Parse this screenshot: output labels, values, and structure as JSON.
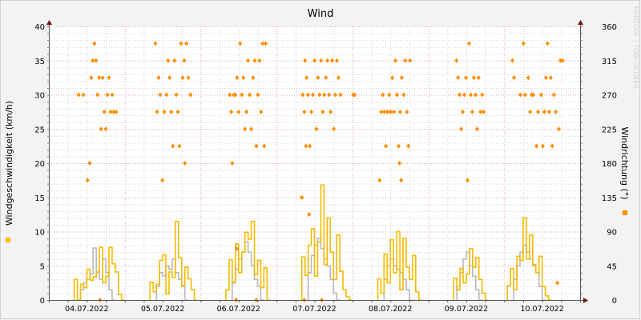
{
  "chart_data": {
    "type": "line",
    "title": "Wind",
    "ylabel": "Windgeschwindigkeit (km/h)",
    "y2label": "Windrichtung (°)",
    "watermark": "RRDTOOL / TOBI OETIKER",
    "ylim": [
      0,
      40
    ],
    "y2lim": [
      0,
      360
    ],
    "yticks": [
      "0",
      "5",
      "10",
      "15",
      "20",
      "25",
      "30",
      "35",
      "40"
    ],
    "y2ticks": [
      "0",
      "45",
      "90",
      "135",
      "180",
      "225",
      "270",
      "315",
      "360"
    ],
    "x_hours_total": 168,
    "xticks": [
      "04.07.2022",
      "05.07.2022",
      "06.07.2022",
      "07.07.2022",
      "08.07.2022",
      "09.07.2022",
      "10.07.2022"
    ],
    "grid": true,
    "colors": {
      "speed": "#F5BA00",
      "secondary": "#B8B8C0",
      "direction": "#FF8C00",
      "axis": "#7a1010"
    },
    "speed_segments": [
      {
        "start": 8,
        "values": [
          3,
          0,
          2.3,
          1.8,
          4.5,
          2.9,
          3.4,
          4.1,
          7.7,
          2.5,
          3.5,
          7.7,
          5.3,
          4.1,
          0.8,
          0
        ]
      },
      {
        "start": 32,
        "values": [
          2.6,
          1.2,
          2.3,
          5.8,
          6.6,
          0.9,
          4.1,
          3.3,
          11.5,
          6.2,
          2.1,
          4.8,
          3.1,
          1.5,
          0
        ]
      },
      {
        "start": 56,
        "values": [
          1.5,
          5.9,
          2.6,
          8.2,
          4,
          7,
          9.9,
          8.9,
          11.5,
          3.7,
          5.8,
          1.8,
          4.7,
          0
        ]
      },
      {
        "start": 80,
        "values": [
          6.3,
          3.6,
          8,
          10.4,
          3.5,
          8.5,
          16.8,
          5.2,
          12,
          7,
          3,
          9.5,
          4.2,
          1.5,
          0.5,
          0
        ]
      },
      {
        "start": 104,
        "values": [
          3.1,
          1,
          6.7,
          2.5,
          8.8,
          4,
          10,
          1.5,
          9,
          4.8,
          3,
          6.5,
          1.2,
          0
        ]
      },
      {
        "start": 128,
        "values": [
          3.2,
          1.5,
          4.6,
          2.5,
          3.8,
          7.5,
          4.8,
          6.2,
          3,
          1,
          0
        ]
      },
      {
        "start": 145,
        "values": [
          2.1,
          4.6,
          1.5,
          6.4,
          5.8,
          12,
          6,
          9.5,
          5.2,
          4,
          6.4,
          2,
          0.6,
          0
        ]
      }
    ],
    "secondary_segments": [
      {
        "start": 10,
        "values": [
          1.5,
          2.5,
          3,
          3.8,
          7.6,
          4,
          3,
          6,
          4,
          1.5,
          0
        ]
      },
      {
        "start": 34,
        "values": [
          2,
          4,
          3.5,
          5,
          4.5,
          6,
          4,
          3,
          2,
          0
        ]
      },
      {
        "start": 58,
        "values": [
          2.5,
          4.5,
          6,
          7,
          8.5,
          7,
          5,
          3,
          2,
          0
        ]
      },
      {
        "start": 82,
        "values": [
          4,
          6.5,
          8,
          9,
          7.5,
          6,
          5,
          3,
          1,
          0
        ]
      },
      {
        "start": 106,
        "values": [
          3,
          5,
          6,
          5,
          4.5,
          4,
          3,
          1.5,
          0
        ]
      },
      {
        "start": 129,
        "values": [
          2,
          4,
          6,
          7,
          5,
          3.5,
          1.5,
          0
        ]
      },
      {
        "start": 147,
        "values": [
          3,
          5,
          7,
          8,
          7,
          6,
          5,
          4,
          2,
          0
        ]
      }
    ],
    "direction_points": [
      [
        9.4,
        270
      ],
      [
        10.9,
        270
      ],
      [
        12.2,
        157.5
      ],
      [
        12.9,
        180
      ],
      [
        13.4,
        292.5
      ],
      [
        13.9,
        315
      ],
      [
        14.4,
        337.5
      ],
      [
        14.9,
        315
      ],
      [
        15.4,
        270
      ],
      [
        15.9,
        292.5
      ],
      [
        16.2,
        0
      ],
      [
        16.5,
        225
      ],
      [
        17,
        292.5
      ],
      [
        17.5,
        247.5
      ],
      [
        18,
        225
      ],
      [
        18.5,
        270
      ],
      [
        19,
        292.5
      ],
      [
        19.5,
        247.5
      ],
      [
        20,
        270
      ],
      [
        20.5,
        247.5
      ],
      [
        21.3,
        247.5
      ],
      [
        33.7,
        337.5
      ],
      [
        34.2,
        247.5
      ],
      [
        34.7,
        292.5
      ],
      [
        35.2,
        270
      ],
      [
        35.9,
        157.5
      ],
      [
        36.5,
        247.5
      ],
      [
        37.2,
        270
      ],
      [
        37.7,
        315
      ],
      [
        38.2,
        292.5
      ],
      [
        38.7,
        247.5
      ],
      [
        39.2,
        202.5
      ],
      [
        39.7,
        315
      ],
      [
        40.3,
        270
      ],
      [
        40.8,
        247.5
      ],
      [
        41.3,
        202.5
      ],
      [
        41.8,
        337.5
      ],
      [
        42.3,
        292.5
      ],
      [
        42.8,
        315
      ],
      [
        43,
        180
      ],
      [
        43.5,
        337.5
      ],
      [
        44.1,
        292.5
      ],
      [
        44.8,
        270
      ],
      [
        57.2,
        270
      ],
      [
        57.7,
        247.5
      ],
      [
        58,
        180
      ],
      [
        58.5,
        270
      ],
      [
        59,
        270
      ],
      [
        59.2,
        0
      ],
      [
        59.4,
        67.5
      ],
      [
        59.5,
        292.5
      ],
      [
        60,
        247.5
      ],
      [
        60.5,
        337.5
      ],
      [
        61,
        270
      ],
      [
        61.5,
        292.5
      ],
      [
        62,
        225
      ],
      [
        62.5,
        247.5
      ],
      [
        63,
        315
      ],
      [
        63.5,
        270
      ],
      [
        64,
        225
      ],
      [
        64.6,
        292.5
      ],
      [
        65.1,
        315
      ],
      [
        65.6,
        0
      ],
      [
        65.6,
        202.5
      ],
      [
        66.1,
        270
      ],
      [
        66.6,
        315
      ],
      [
        67.1,
        247.5
      ],
      [
        67.6,
        337.5
      ],
      [
        68.1,
        202.5
      ],
      [
        68.6,
        337.5
      ],
      [
        80,
        135
      ],
      [
        80.3,
        270
      ],
      [
        80.8,
        0
      ],
      [
        80.8,
        247.5
      ],
      [
        81,
        315
      ],
      [
        81.3,
        202.5
      ],
      [
        81.5,
        292.5
      ],
      [
        82,
        270
      ],
      [
        82.3,
        112.5
      ],
      [
        82.5,
        202.5
      ],
      [
        83,
        247.5
      ],
      [
        83.5,
        270
      ],
      [
        84,
        315
      ],
      [
        84.6,
        225
      ],
      [
        85.1,
        292.5
      ],
      [
        85.6,
        270
      ],
      [
        86.1,
        315
      ],
      [
        86.3,
        0
      ],
      [
        86.6,
        247.5
      ],
      [
        87.1,
        270
      ],
      [
        87.6,
        292.5
      ],
      [
        88.1,
        315
      ],
      [
        88.6,
        270
      ],
      [
        89.1,
        247.5
      ],
      [
        89.6,
        315
      ],
      [
        90.1,
        225
      ],
      [
        90.6,
        270
      ],
      [
        91.1,
        315
      ],
      [
        91.6,
        292.5
      ],
      [
        92.2,
        270
      ],
      [
        96.2,
        270
      ],
      [
        96.7,
        270
      ],
      [
        104.6,
        157.5
      ],
      [
        105.1,
        247.5
      ],
      [
        105.6,
        270
      ],
      [
        106.1,
        247.5
      ],
      [
        106.6,
        202.5
      ],
      [
        107.1,
        247.5
      ],
      [
        107.6,
        270
      ],
      [
        108.1,
        247.5
      ],
      [
        108.6,
        292.5
      ],
      [
        109.1,
        247.5
      ],
      [
        109.6,
        315
      ],
      [
        110.1,
        270
      ],
      [
        110.6,
        202.5
      ],
      [
        110.9,
        180
      ],
      [
        111.1,
        247.5
      ],
      [
        111.4,
        157.5
      ],
      [
        111.6,
        292.5
      ],
      [
        112.2,
        270
      ],
      [
        112.7,
        315
      ],
      [
        113.2,
        247.5
      ],
      [
        113.7,
        202.5
      ],
      [
        114.2,
        315
      ],
      [
        128.9,
        315
      ],
      [
        129.4,
        292.5
      ],
      [
        129.9,
        270
      ],
      [
        130.4,
        225
      ],
      [
        130.9,
        247.5
      ],
      [
        131.4,
        270
      ],
      [
        131.9,
        292.5
      ],
      [
        132.4,
        157.5
      ],
      [
        132.9,
        337.5
      ],
      [
        133.4,
        270
      ],
      [
        133.9,
        247.5
      ],
      [
        134.4,
        292.5
      ],
      [
        134.9,
        270
      ],
      [
        135.4,
        225
      ],
      [
        135.9,
        292.5
      ],
      [
        136.5,
        247.5
      ],
      [
        137,
        270
      ],
      [
        137.5,
        247.5
      ],
      [
        146.6,
        315
      ],
      [
        147.1,
        292.5
      ],
      [
        149.1,
        270
      ],
      [
        150.1,
        337.5
      ],
      [
        150.6,
        270
      ],
      [
        151.6,
        292.5
      ],
      [
        152.2,
        247.5
      ],
      [
        152.7,
        270
      ],
      [
        153.2,
        270
      ],
      [
        154.2,
        202.5
      ],
      [
        154.7,
        247.5
      ],
      [
        155.7,
        270
      ],
      [
        156.2,
        202.5
      ],
      [
        156.7,
        247.5
      ],
      [
        157.2,
        292.5
      ],
      [
        157.7,
        337.5
      ],
      [
        158.2,
        247.5
      ],
      [
        158.7,
        292.5
      ],
      [
        159.2,
        202.5
      ],
      [
        159.7,
        270
      ],
      [
        160.3,
        247.5
      ],
      [
        160.8,
        22.5
      ],
      [
        161.3,
        225
      ],
      [
        161.8,
        315
      ],
      [
        162.5,
        315
      ]
    ]
  }
}
